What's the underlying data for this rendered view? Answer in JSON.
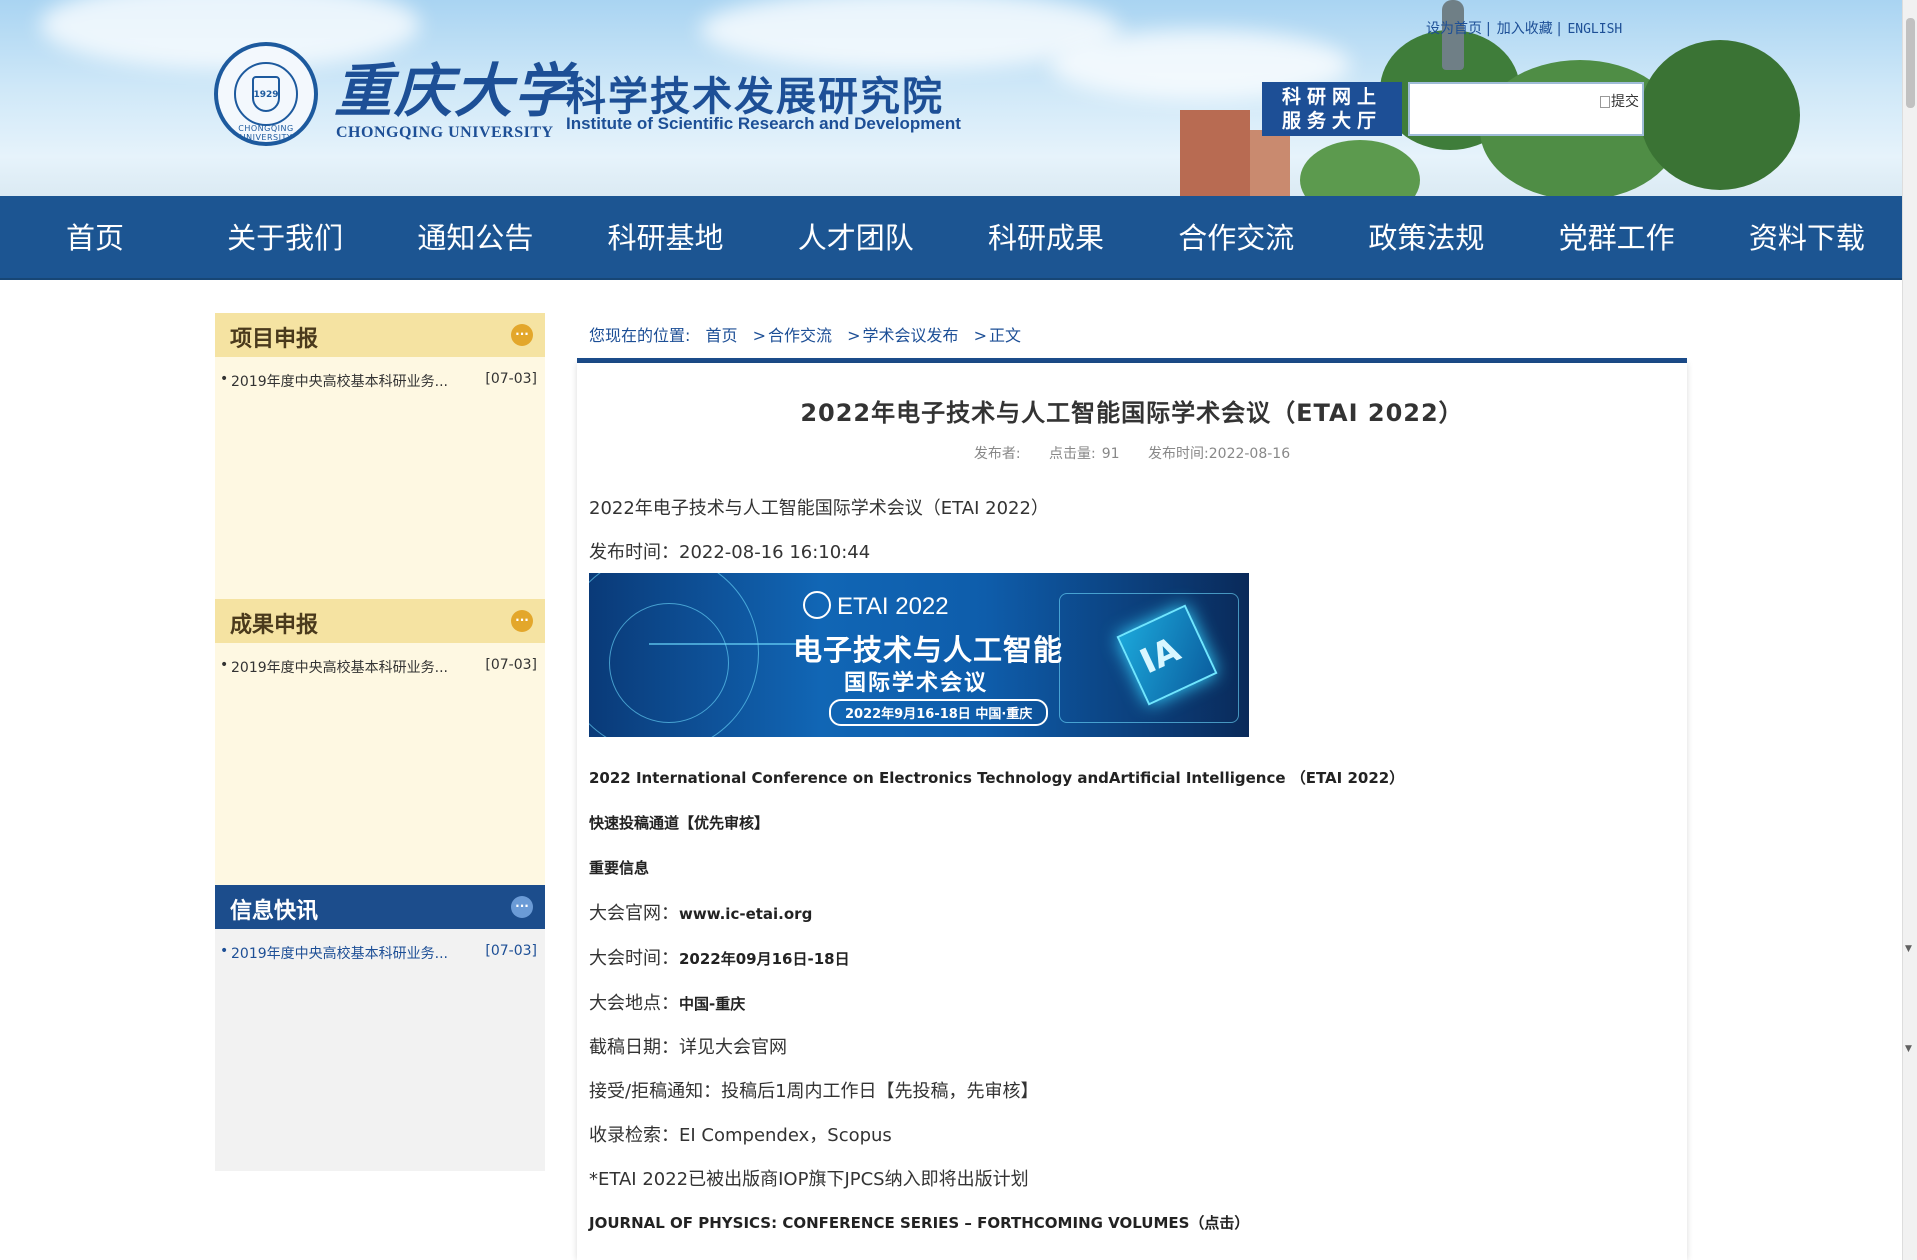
{
  "header": {
    "university_cn": "重庆大学",
    "university_en": "CHONGQING UNIVERSITY",
    "seal_text": "CHONGQING UNIVERSITY",
    "seal_year": "1929",
    "institute_cn": "科学技术发展研究院",
    "institute_en": "Institute of Scientific Research and Development",
    "top_links": {
      "set_home": "设为首页",
      "bookmark": "加入收藏",
      "english": "ENGLISH",
      "separator": "|"
    },
    "service_line1": "科研网上",
    "service_line2": "服务大厅",
    "search": {
      "value": "",
      "submit_alt": "提交"
    }
  },
  "nav": {
    "items": [
      "首页",
      "关于我们",
      "通知公告",
      "科研基地",
      "人才团队",
      "科研成果",
      "合作交流",
      "政策法规",
      "党群工作",
      "资料下载"
    ]
  },
  "sidebar": {
    "blocks": [
      {
        "title": "项目申报",
        "more": "···",
        "items": [
          {
            "bullet": "•",
            "text": "2019年度中央高校基本科研业务...",
            "date": "[07-03]"
          }
        ]
      },
      {
        "title": "成果申报",
        "more": "···",
        "items": [
          {
            "bullet": "•",
            "text": "2019年度中央高校基本科研业务...",
            "date": "[07-03]"
          }
        ]
      },
      {
        "title": "信息快讯",
        "more": "···",
        "items": [
          {
            "bullet": "•",
            "text": "2019年度中央高校基本科研业务...",
            "date": "[07-03]"
          }
        ]
      }
    ]
  },
  "breadcrumb": {
    "lead": "您现在的位置:",
    "items": [
      "首页",
      "合作交流",
      "学术会议发布",
      "正文"
    ],
    "arrow": ">"
  },
  "article": {
    "title": "2022年电子技术与人工智能国际学术会议（ETAI 2022）",
    "meta": {
      "publisher": "发布者:",
      "clicks_label": "点击量:",
      "clicks": "91",
      "time_label": "发布时间:",
      "time": "2022-08-16"
    },
    "banner": {
      "line1": "ETAI 2022",
      "line2": "电子技术与人工智能",
      "line3": "国际学术会议",
      "line4": "2022年9月16-18日 中国·重庆",
      "chip": "IA"
    },
    "paragraphs": {
      "p1": "2022年电子技术与人工智能国际学术会议（ETAI 2022）",
      "p2": "发布时间：2022-08-16 16:10:44",
      "p3": "2022 International Conference on Electronics Technology andArtificial Intelligence （ETAI 2022）",
      "p4": "快速投稿通道【优先审核】",
      "p5": "重要信息",
      "p6_label": "大会官网：",
      "p6_value": "www.ic-etai.org",
      "p7_label": "大会时间：",
      "p7_value": "2022年09月16日-18日",
      "p8_label": "大会地点：",
      "p8_value": "中国-重庆",
      "p9": "截稿日期：详见大会官网",
      "p10": "接受/拒稿通知：投稿后1周内工作日【先投稿，先审核】",
      "p11": "收录检索：EI Compendex，Scopus",
      "p12": "*ETAI 2022已被出版商IOP旗下JPCS纳入即将出版计划",
      "p13": "JOURNAL OF PHYSICS: CONFERENCE SERIES – FORTHCOMING VOLUMES（点击）"
    }
  },
  "colors": {
    "nav": "#1c5592",
    "accent": "#1d4f96",
    "sidebar_head": "#f5e3a2",
    "sidebar_body": "#fef8e2",
    "more_icon": "#e3a72b"
  }
}
